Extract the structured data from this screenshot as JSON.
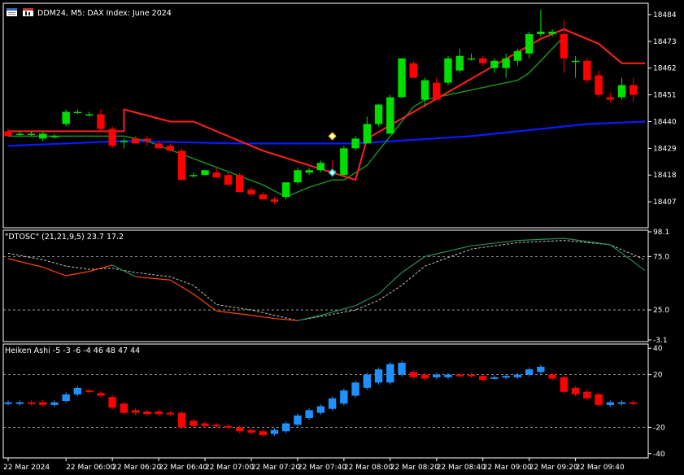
{
  "window": {
    "title": "DDM24, M5:  DAX Index: June 2024",
    "icons": [
      "chart-window-icon",
      "chart-type-icon"
    ]
  },
  "colors": {
    "bull": "#00e000",
    "bear": "#ff0000",
    "fast_line": "#ff2020",
    "slow_line": "#1e8c1e",
    "ma_line": "#0a1aff",
    "osc_main": "#ff4500",
    "osc_green": "#2e8b57",
    "osc_signal": "#c0c0c0",
    "ha_up": "#2090ff",
    "ha_down": "#ff0000",
    "grid": "#ffffff",
    "marker_up": "#ffd700",
    "marker_down": "#00ced1"
  },
  "chart_data": [
    {
      "type": "candlestick",
      "panel": "price",
      "ylim": [
        18397,
        18488
      ],
      "yticks": [
        18407,
        18418,
        18429,
        18440,
        18451,
        18462,
        18473,
        18484
      ],
      "candles": [
        [
          18436,
          18437,
          18434,
          18434
        ],
        [
          18435,
          18436,
          18434,
          18435
        ],
        [
          18435,
          18436,
          18434,
          18435
        ],
        [
          18433,
          18436,
          18432,
          18435
        ],
        [
          18434,
          18435,
          18433,
          18434
        ],
        [
          18439,
          18445,
          18438,
          18444
        ],
        [
          18444,
          18445,
          18443,
          18444
        ],
        [
          18443,
          18444,
          18442,
          18443
        ],
        [
          18443,
          18445,
          18436,
          18437
        ],
        [
          18437,
          18438,
          18429,
          18430
        ],
        [
          18432,
          18433,
          18429,
          18432
        ],
        [
          18433,
          18434,
          18431,
          18431
        ],
        [
          18433,
          18434,
          18430,
          18432
        ],
        [
          18431,
          18432,
          18429,
          18429
        ],
        [
          18430,
          18431,
          18428,
          18428
        ],
        [
          18428,
          18429,
          18416,
          18416
        ],
        [
          18418,
          18419,
          18417,
          18418
        ],
        [
          18418,
          18420,
          18418,
          18420
        ],
        [
          18419,
          18421,
          18417,
          18417
        ],
        [
          18418,
          18419,
          18414,
          18414
        ],
        [
          18418,
          18419,
          18411,
          18411
        ],
        [
          18412,
          18413,
          18410,
          18410
        ],
        [
          18410,
          18411,
          18408,
          18408
        ],
        [
          18408,
          18409,
          18406,
          18407
        ],
        [
          18409,
          18415,
          18408,
          18415
        ],
        [
          18415,
          18421,
          18414,
          18420
        ],
        [
          18419,
          18421,
          18418,
          18420
        ],
        [
          18420,
          18424,
          18419,
          18423
        ],
        [
          18420,
          18424,
          18417,
          18419
        ],
        [
          18418,
          18430,
          18418,
          18429
        ],
        [
          18429,
          18434,
          18428,
          18433
        ],
        [
          18431,
          18442,
          18431,
          18439
        ],
        [
          18439,
          18447,
          18438,
          18447
        ],
        [
          18435,
          18451,
          18435,
          18450
        ],
        [
          18450,
          18466,
          18450,
          18466
        ],
        [
          18464,
          18465,
          18458,
          18458
        ],
        [
          18449,
          18458,
          18446,
          18457
        ],
        [
          18456,
          18458,
          18449,
          18449
        ],
        [
          18456,
          18467,
          18455,
          18466
        ],
        [
          18461,
          18470,
          18460,
          18467
        ],
        [
          18466,
          18468,
          18465,
          18466
        ],
        [
          18466,
          18467,
          18463,
          18464
        ],
        [
          18462,
          18466,
          18460,
          18465
        ],
        [
          18462,
          18468,
          18458,
          18466
        ],
        [
          18465,
          18470,
          18463,
          18469
        ],
        [
          18468,
          18477,
          18466,
          18476
        ],
        [
          18476,
          18486,
          18475,
          18477
        ],
        [
          18476,
          18478,
          18475,
          18477
        ],
        [
          18476,
          18482,
          18460,
          18466
        ],
        [
          18465,
          18467,
          18458,
          18465
        ],
        [
          18465,
          18466,
          18456,
          18457
        ],
        [
          18459,
          18461,
          18450,
          18451
        ],
        [
          18450,
          18452,
          18448,
          18449
        ],
        [
          18450,
          18458,
          18449,
          18455
        ],
        [
          18455,
          18458,
          18448,
          18451
        ]
      ],
      "overlays": {
        "upper_line": [
          [
            0,
            18436
          ],
          [
            10,
            18436
          ],
          [
            10,
            18445
          ],
          [
            14,
            18440
          ],
          [
            16,
            18440
          ],
          [
            22,
            18428
          ],
          [
            30,
            18416
          ],
          [
            31,
            18433
          ],
          [
            46,
            18474
          ],
          [
            48,
            18478
          ],
          [
            49,
            18476
          ],
          [
            51,
            18472
          ],
          [
            53,
            18464
          ],
          [
            55,
            18464
          ]
        ],
        "lower_line": [
          [
            0,
            18434
          ],
          [
            10,
            18434
          ],
          [
            12,
            18432
          ],
          [
            22,
            18414
          ],
          [
            24,
            18409
          ],
          [
            26,
            18413
          ],
          [
            28,
            18416
          ],
          [
            29,
            18416
          ],
          [
            31,
            18422
          ],
          [
            35,
            18446
          ],
          [
            36,
            18449
          ],
          [
            38,
            18451
          ],
          [
            44,
            18457
          ],
          [
            45,
            18460
          ],
          [
            46,
            18465
          ],
          [
            48,
            18475
          ]
        ],
        "moving_average": [
          [
            0,
            18430
          ],
          [
            10,
            18432
          ],
          [
            20,
            18431
          ],
          [
            30,
            18431
          ],
          [
            40,
            18434
          ],
          [
            50,
            18439
          ],
          [
            55,
            18440
          ]
        ],
        "markers": [
          {
            "index": 28,
            "value": 18434,
            "kind": "up"
          },
          {
            "index": 28,
            "value": 18419,
            "kind": "down"
          }
        ]
      }
    },
    {
      "type": "line",
      "panel": "oscillator",
      "label": "\"DTOSC\" (21,21,9,5) 23.7 17.2",
      "ylim": [
        -3.1,
        98.1
      ],
      "yticks": [
        -3.1,
        25.0,
        75.0,
        98.1
      ],
      "levels": [
        25.0,
        75.0
      ],
      "series": [
        {
          "role": "main",
          "points": [
            [
              0,
              73
            ],
            [
              3,
              65
            ],
            [
              5,
              57
            ],
            [
              7,
              61
            ],
            [
              9,
              67
            ],
            [
              11,
              56
            ],
            [
              14,
              53
            ],
            [
              16,
              40
            ],
            [
              18,
              24
            ],
            [
              21,
              20
            ],
            [
              23,
              17
            ],
            [
              25,
              15
            ],
            [
              27,
              20
            ],
            [
              30,
              29
            ],
            [
              32,
              40
            ],
            [
              34,
              60
            ],
            [
              36,
              75
            ],
            [
              40,
              85
            ],
            [
              44,
              90
            ],
            [
              48,
              92
            ],
            [
              52,
              86
            ],
            [
              55,
              62
            ]
          ]
        },
        {
          "role": "signal",
          "points": [
            [
              0,
              78
            ],
            [
              3,
              72
            ],
            [
              5,
              66
            ],
            [
              7,
              63
            ],
            [
              9,
              64
            ],
            [
              11,
              60
            ],
            [
              14,
              56
            ],
            [
              16,
              48
            ],
            [
              18,
              30
            ],
            [
              21,
              25
            ],
            [
              23,
              20
            ],
            [
              25,
              15
            ],
            [
              27,
              19
            ],
            [
              30,
              25
            ],
            [
              32,
              34
            ],
            [
              34,
              48
            ],
            [
              36,
              66
            ],
            [
              40,
              82
            ],
            [
              44,
              88
            ],
            [
              48,
              90
            ],
            [
              52,
              86
            ],
            [
              55,
              72
            ]
          ]
        }
      ]
    },
    {
      "type": "candlestick",
      "panel": "heiken_ashi",
      "label": "Heiken Ashi -5 -3 -6 -4 46 48 47 44",
      "ylim": [
        -42,
        42
      ],
      "yticks": [
        -40,
        -20,
        20,
        40
      ],
      "levels": [
        -20,
        20
      ],
      "candles": [
        [
          -2,
          -1
        ],
        [
          -2,
          -1
        ],
        [
          -1,
          -2
        ],
        [
          -1,
          -3
        ],
        [
          -3,
          -1
        ],
        [
          0,
          5
        ],
        [
          5,
          10
        ],
        [
          8,
          7
        ],
        [
          6,
          4
        ],
        [
          3,
          -5
        ],
        [
          -2,
          -9
        ],
        [
          -7,
          -9
        ],
        [
          -8,
          -10
        ],
        [
          -8,
          -10
        ],
        [
          -9,
          -10
        ],
        [
          -9,
          -20
        ],
        [
          -15,
          -19
        ],
        [
          -17,
          -19
        ],
        [
          -18,
          -19
        ],
        [
          -19,
          -20
        ],
        [
          -20,
          -23
        ],
        [
          -22,
          -24
        ],
        [
          -23,
          -26
        ],
        [
          -25,
          -22
        ],
        [
          -23,
          -17
        ],
        [
          -18,
          -11
        ],
        [
          -13,
          -7
        ],
        [
          -9,
          -4
        ],
        [
          -6,
          2
        ],
        [
          -2,
          8
        ],
        [
          4,
          14
        ],
        [
          10,
          20
        ],
        [
          14,
          24
        ],
        [
          14,
          28
        ],
        [
          20,
          29
        ],
        [
          22,
          18
        ],
        [
          20,
          17
        ],
        [
          18,
          20
        ],
        [
          18,
          20
        ],
        [
          20,
          19
        ],
        [
          20,
          19
        ],
        [
          19,
          16
        ],
        [
          18,
          18
        ],
        [
          18,
          19
        ],
        [
          18,
          20
        ],
        [
          20,
          24
        ],
        [
          22,
          26
        ],
        [
          20,
          17
        ],
        [
          18,
          7
        ],
        [
          10,
          5
        ],
        [
          7,
          2
        ],
        [
          5,
          -3
        ],
        [
          -3,
          -1
        ],
        [
          -2,
          -1
        ],
        [
          -1,
          -2
        ]
      ]
    }
  ],
  "x_axis": {
    "labels": [
      {
        "text": "22 Mar 2024",
        "index": 0
      },
      {
        "text": "22 Mar 06:00",
        "index": 5
      },
      {
        "text": "22 Mar 06:20",
        "index": 9
      },
      {
        "text": "22 Mar 06:40",
        "index": 13
      },
      {
        "text": "22 Mar 07:00",
        "index": 17
      },
      {
        "text": "22 Mar 07:20",
        "index": 21
      },
      {
        "text": "22 Mar 07:40",
        "index": 25
      },
      {
        "text": "22 Mar 08:00",
        "index": 29
      },
      {
        "text": "22 Mar 08:20",
        "index": 33
      },
      {
        "text": "22 Mar 08:40",
        "index": 37
      },
      {
        "text": "22 Mar 09:00",
        "index": 41
      },
      {
        "text": "22 Mar 09:20",
        "index": 45
      },
      {
        "text": "22 Mar 09:40",
        "index": 49
      }
    ]
  }
}
